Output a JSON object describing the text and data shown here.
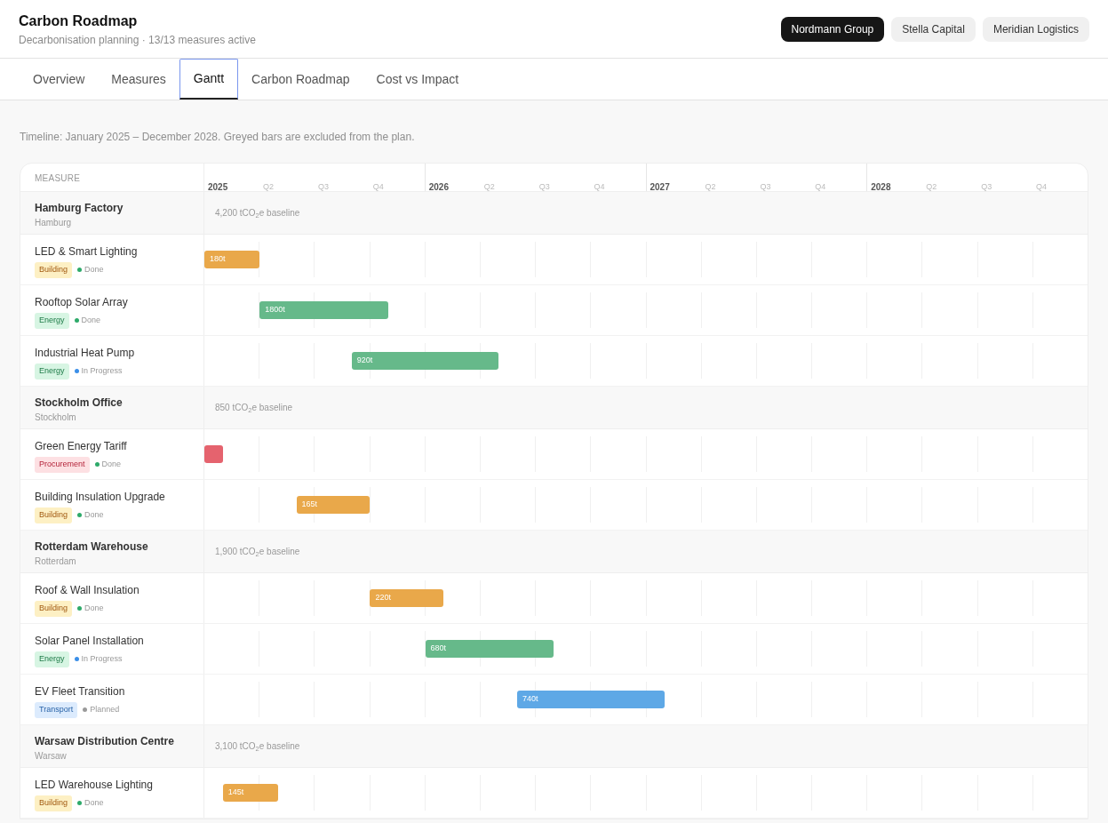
{
  "header": {
    "title": "Carbon Roadmap",
    "subtitle": "Decarbonisation planning · 13/13 measures active"
  },
  "companies": [
    {
      "label": "Nordmann Group",
      "selected": true
    },
    {
      "label": "Stella Capital",
      "selected": false
    },
    {
      "label": "Meridian Logistics",
      "selected": false
    }
  ],
  "tabs": [
    {
      "label": "Overview",
      "selected": false
    },
    {
      "label": "Measures",
      "selected": false
    },
    {
      "label": "Gantt",
      "selected": true
    },
    {
      "label": "Carbon Roadmap",
      "selected": false
    },
    {
      "label": "Cost vs Impact",
      "selected": false
    }
  ],
  "note": "Timeline: January 2025 – December 2028. Greyed bars are excluded from the plan.",
  "gantt": {
    "measure_header": "MEASURE",
    "years": [
      {
        "label": "2025",
        "quarters": [
          "Q2",
          "Q3",
          "Q4"
        ]
      },
      {
        "label": "2026",
        "quarters": [
          "Q2",
          "Q3",
          "Q4"
        ]
      },
      {
        "label": "2027",
        "quarters": [
          "Q2",
          "Q3",
          "Q4"
        ]
      },
      {
        "label": "2028",
        "quarters": [
          "Q2",
          "Q3",
          "Q4"
        ]
      }
    ],
    "sites": [
      {
        "name": "Hamburg Factory",
        "city": "Hamburg",
        "baseline": "4,200 tCO$_{2}$e baseline",
        "measures": [
          {
            "name": "LED & Smart Lighting",
            "category": "Building",
            "kind": "building",
            "status": "Done",
            "color": "#2eaa6a",
            "bar_label": "180t"
          },
          {
            "name": "Rooftop Solar Array",
            "category": "Energy",
            "kind": "energy",
            "status": "Done",
            "color": "#2eaa6a",
            "bar_label": "1800t"
          },
          {
            "name": "Industrial Heat Pump",
            "category": "Energy",
            "kind": "energy",
            "status": "In Progress",
            "color": "#3b8fe8",
            "bar_label": "920t"
          }
        ]
      },
      {
        "name": "Stockholm Office",
        "city": "Stockholm",
        "baseline": "850 tCO$_{2}$e baseline",
        "measures": [
          {
            "name": "Green Energy Tariff",
            "category": "Procurement",
            "kind": "procurement",
            "status": "Done",
            "color": "#2eaa6a"
          },
          {
            "name": "Building Insulation Upgrade",
            "category": "Building",
            "kind": "building",
            "status": "Done",
            "color": "#2eaa6a",
            "bar_label": "165t"
          }
        ]
      },
      {
        "name": "Rotterdam Warehouse",
        "city": "Rotterdam",
        "baseline": "1,900 tCO$_{2}$e baseline",
        "measures": [
          {
            "name": "Roof & Wall Insulation",
            "category": "Building",
            "kind": "building",
            "status": "Done",
            "color": "#2eaa6a",
            "bar_label": "220t"
          },
          {
            "name": "Solar Panel Installation",
            "category": "Energy",
            "kind": "energy",
            "status": "In Progress",
            "color": "#3b8fe8",
            "bar_label": "680t"
          },
          {
            "name": "EV Fleet Transition",
            "category": "Transport",
            "kind": "transport",
            "status": "Planned",
            "color": "#9a9a9a",
            "bar_label": "740t"
          }
        ]
      },
      {
        "name": "Warsaw Distribution Centre",
        "city": "Warsaw",
        "baseline": "3,100 tCO$_{2}$e baseline",
        "measures": [
          {
            "name": "LED Warehouse Lighting",
            "category": "Building",
            "kind": "building",
            "status": "Done",
            "color": "#2eaa6a",
            "bar_label": "145t"
          }
        ]
      }
    ]
  }
}
